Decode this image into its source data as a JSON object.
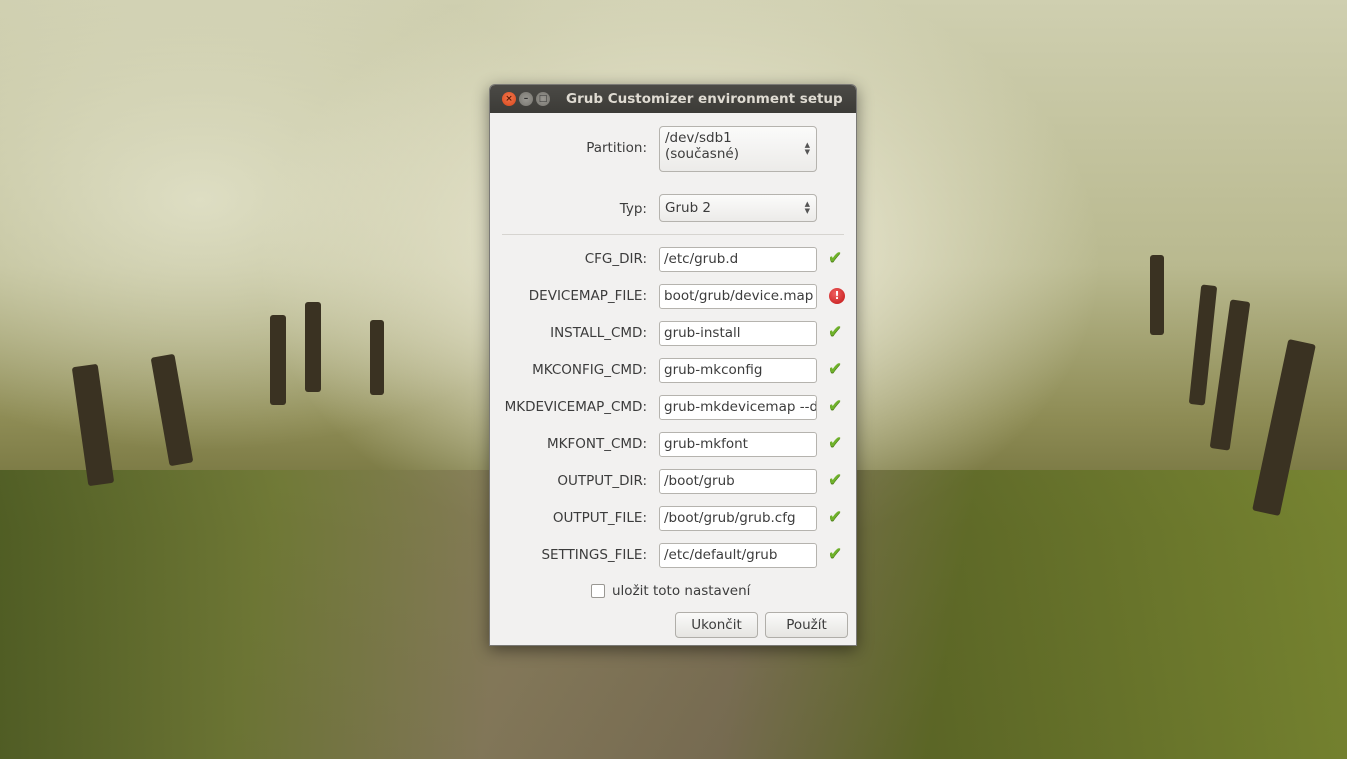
{
  "window": {
    "title": "Grub Customizer environment setup",
    "close": "×",
    "minimize": "–",
    "maximize": "□"
  },
  "partition": {
    "label": "Partition:",
    "value_line1": "/dev/sdb1",
    "value_line2": "(současné)"
  },
  "type": {
    "label": "Typ:",
    "value": "Grub 2"
  },
  "fields": [
    {
      "label": "CFG_DIR:",
      "value": "/etc/grub.d",
      "status": "ok"
    },
    {
      "label": "DEVICEMAP_FILE:",
      "value": "boot/grub/device.map",
      "status": "error"
    },
    {
      "label": "INSTALL_CMD:",
      "value": "grub-install",
      "status": "ok"
    },
    {
      "label": "MKCONFIG_CMD:",
      "value": "grub-mkconfig",
      "status": "ok"
    },
    {
      "label": "MKDEVICEMAP_CMD:",
      "value": "grub-mkdevicemap --de",
      "status": "ok"
    },
    {
      "label": "MKFONT_CMD:",
      "value": "grub-mkfont",
      "status": "ok"
    },
    {
      "label": "OUTPUT_DIR:",
      "value": "/boot/grub",
      "status": "ok"
    },
    {
      "label": "OUTPUT_FILE:",
      "value": "/boot/grub/grub.cfg",
      "status": "ok"
    },
    {
      "label": "SETTINGS_FILE:",
      "value": "/etc/default/grub",
      "status": "ok"
    }
  ],
  "icons": {
    "ok": "✔",
    "error": "!"
  },
  "save_checkbox": {
    "label": "uložit toto nastavení",
    "checked": false
  },
  "buttons": {
    "quit": "Ukončit",
    "apply": "Použít"
  }
}
